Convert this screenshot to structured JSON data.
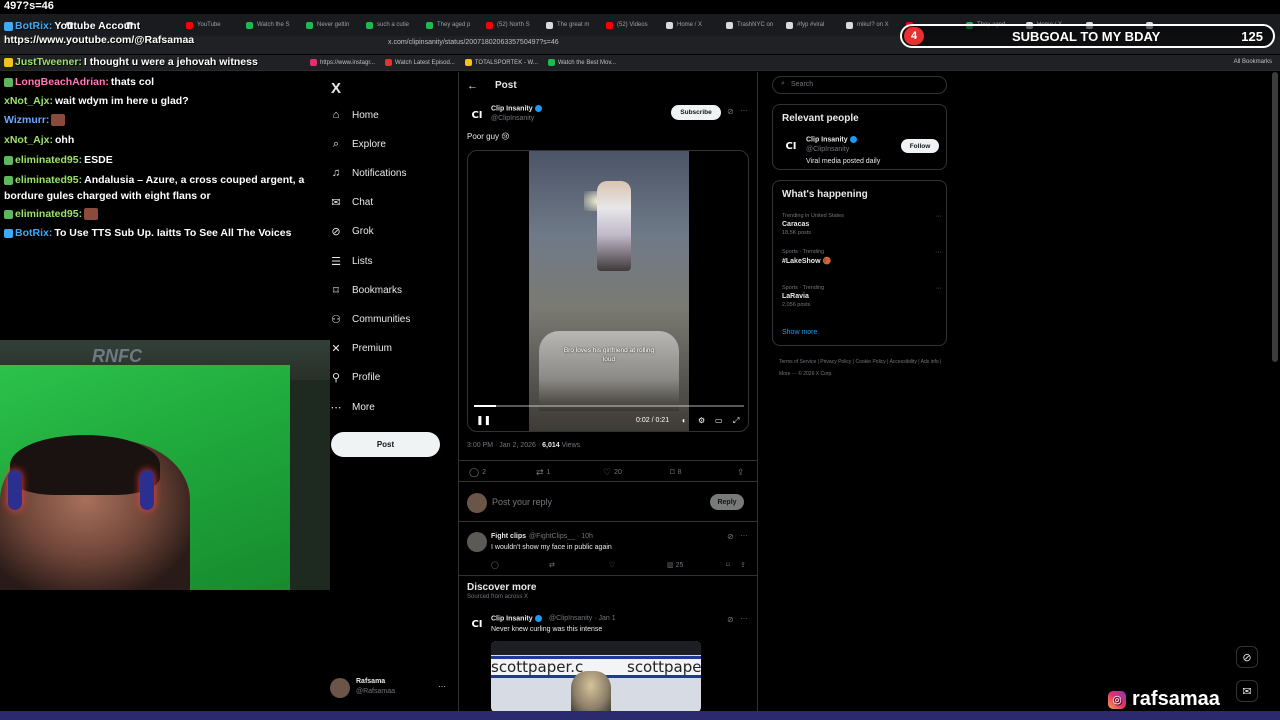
{
  "stream": {
    "url_fragment": "497?s=46",
    "subgoal": {
      "count": "4",
      "label": "SUBGOAL TO MY BDAY",
      "value": "125"
    },
    "instagram_handle": "rafsamaa"
  },
  "browser": {
    "tabs": [
      {
        "label": "",
        "color": "#d9d9d9"
      },
      {
        "label": "",
        "color": "#d9d9d9"
      },
      {
        "label": "",
        "color": "#d9d9d9"
      },
      {
        "label": "YouTube",
        "color": "#ff0000"
      },
      {
        "label": "Watch the S",
        "color": "#1db954"
      },
      {
        "label": "Never gettin",
        "color": "#1db954"
      },
      {
        "label": "such a cutie",
        "color": "#1db954"
      },
      {
        "label": "They aged p",
        "color": "#1db954"
      },
      {
        "label": "(52) North S",
        "color": "#ff0000"
      },
      {
        "label": "The great m",
        "color": "#d9d9d9"
      },
      {
        "label": "(52) Videos",
        "color": "#ff0000"
      },
      {
        "label": "Home / X",
        "color": "#d9d9d9"
      },
      {
        "label": "TrashNYC on",
        "color": "#d9d9d9"
      },
      {
        "label": "#fyp #viral",
        "color": "#d9d9d9"
      },
      {
        "label": "miku!? on X",
        "color": "#d9d9d9"
      },
      {
        "label": "",
        "color": "#ff0000"
      },
      {
        "label": "They aged",
        "color": "#1db954"
      },
      {
        "label": "Home / X",
        "color": "#d9d9d9"
      },
      {
        "label": "",
        "color": "#d9d9d9"
      },
      {
        "label": "",
        "color": "#d9d9d9"
      }
    ],
    "url": "x.com/clipinsanity/status/2007180206335750497?s=46",
    "bookmarks": [
      {
        "label": "https://www.instagr...",
        "color": "#e1306c"
      },
      {
        "label": "Watch Latest Episod...",
        "color": "#e5312f"
      },
      {
        "label": "TOTALSPORTEK - W...",
        "color": "#f0c419"
      },
      {
        "label": "Watch the Best Mov...",
        "color": "#1db954"
      }
    ],
    "all_bookmarks": "All Bookmarks"
  },
  "chat": [
    {
      "name": "BotRix:",
      "name_color": "#3fa9f5",
      "message": "Youtube Account",
      "badge": "b"
    },
    {
      "name": "",
      "name_color": "#ffffff",
      "message": "https://www.youtube.com/@Rafsamaa",
      "badge": ""
    },
    {
      "name": "JustTweener:",
      "name_color": "#9be36b",
      "message": "I thought u were a jehovah witness",
      "badge": "y"
    },
    {
      "name": "LongBeachAdrian:",
      "name_color": "#ff7ab6",
      "message": "thats col",
      "badge": "g"
    },
    {
      "name": "xNot_Ajx:",
      "name_color": "#9be36b",
      "message": "wait wdym im here u glad?",
      "badge": ""
    },
    {
      "name": "Wizmurr:",
      "name_color": "#6aa8ff",
      "message": "",
      "badge": ""
    },
    {
      "name": "xNot_Ajx:",
      "name_color": "#9be36b",
      "message": "ohh",
      "badge": ""
    },
    {
      "name": "eliminated95:",
      "name_color": "#9be36b",
      "message": "ESDE",
      "badge": "g"
    },
    {
      "name": "eliminated95:",
      "name_color": "#9be36b",
      "message": "Andalusia – Azure, a cross couped argent, a bordure gules charged with eight flans or",
      "badge": "g"
    },
    {
      "name": "eliminated95:",
      "name_color": "#9be36b",
      "message": "",
      "badge": "g"
    },
    {
      "name": "BotRix:",
      "name_color": "#3fa9f5",
      "message": "To Use TTS Sub Up. Iaitts To See All The Voices",
      "badge": "b"
    }
  ],
  "webcam": {
    "logo": "RNFC"
  },
  "x_nav": {
    "logo": "X",
    "items": [
      {
        "label": "Home",
        "icon": "home-icon",
        "glyph": "⌂"
      },
      {
        "label": "Explore",
        "icon": "search-icon",
        "glyph": "⌕"
      },
      {
        "label": "Notifications",
        "icon": "bell-icon",
        "glyph": "♫"
      },
      {
        "label": "Chat",
        "icon": "mail-icon",
        "glyph": "✉"
      },
      {
        "label": "Grok",
        "icon": "grok-icon",
        "glyph": "⊘"
      },
      {
        "label": "Lists",
        "icon": "list-icon",
        "glyph": "☰"
      },
      {
        "label": "Bookmarks",
        "icon": "bookmark-icon",
        "glyph": "⌑"
      },
      {
        "label": "Communities",
        "icon": "people-icon",
        "glyph": "⚇"
      },
      {
        "label": "Premium",
        "icon": "x-premium-icon",
        "glyph": "✕"
      },
      {
        "label": "Profile",
        "icon": "user-icon",
        "glyph": "⚲"
      },
      {
        "label": "More",
        "icon": "more-circle-icon",
        "glyph": "⋯"
      }
    ],
    "post_button": "Post",
    "account": {
      "name": "Rafsama",
      "handle": "@Rafsamaa",
      "more": "···"
    }
  },
  "post": {
    "header": "Post",
    "author": {
      "avatar_text": "CI",
      "name": "Clip Insanity",
      "handle": "@ClipInsanity"
    },
    "subscribe_label": "Subscribe",
    "text": "Poor guy 😢",
    "video": {
      "caption": "Bro loves his girlfriend at rolling loud",
      "time": "0:02 / 0:21",
      "progress": 0.08
    },
    "meta": {
      "time": "3:00 PM · Jan 2, 2026 · ",
      "views": "6,014",
      "views_label": " Views"
    },
    "actions": {
      "replies": "2",
      "reposts": "1",
      "likes": "20",
      "bookmarks": "8"
    }
  },
  "reply": {
    "placeholder": "Post your reply",
    "button": "Reply"
  },
  "fight_reply": {
    "name": "Fight clips",
    "meta": "@FightClips__ · 10h",
    "text": "I wouldn't show my face in public again",
    "views": "25"
  },
  "discover": {
    "title": "Discover more",
    "subtitle": "Sourced from across X",
    "post": {
      "avatar_text": "CI",
      "name": "Clip Insanity",
      "meta": "@ClipInsanity · Jan 1",
      "text": "Never knew curling was this intense",
      "image_text_left": "scottpaper.c",
      "image_text_right": "scottpaper"
    }
  },
  "right": {
    "search_placeholder": "Search",
    "relevant": {
      "title": "Relevant people",
      "avatar_text": "CI",
      "name": "Clip Insanity",
      "handle": "@ClipInsanity",
      "bio": "Viral media posted daily",
      "follow": "Follow"
    },
    "happening": {
      "title": "What's happening",
      "trends": [
        {
          "context": "Trending in United States",
          "name": "Caracas",
          "count": "18.5K posts"
        },
        {
          "context": "Sports · Trending",
          "name": "#LakeShow 🏀",
          "count": ""
        },
        {
          "context": "Sports · Trending",
          "name": "LaRavia",
          "count": "2,056 posts"
        }
      ],
      "show_more": "Show more"
    },
    "footer": "Terms of Service  |  Privacy Policy  |  Cookie Policy  |  Accessibility  |  Ads info  |  More ···  © 2026 X Corp."
  }
}
